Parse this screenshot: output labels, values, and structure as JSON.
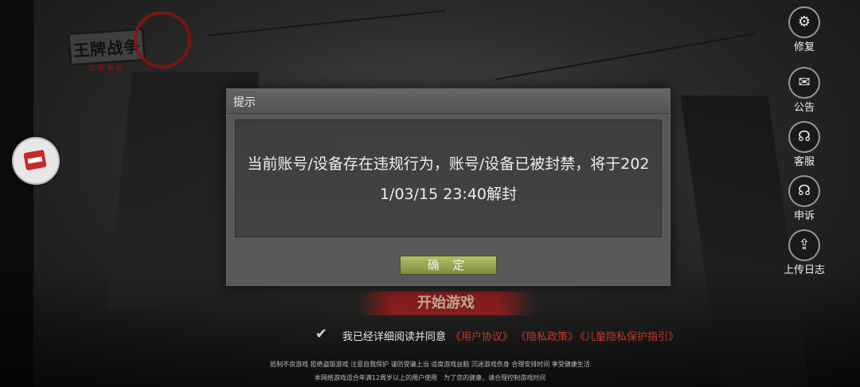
{
  "logo": {
    "text": "王牌战争",
    "subtitle": "文明重启"
  },
  "side_button": {
    "icon": "ruler-icon"
  },
  "right_menu": [
    {
      "label": "修复",
      "icon": "gear-icon"
    },
    {
      "label": "公告",
      "icon": "notice-icon"
    },
    {
      "label": "客服",
      "icon": "headset-icon"
    },
    {
      "label": "申诉",
      "icon": "headset-icon"
    },
    {
      "label": "上传日志",
      "icon": "upload-icon"
    }
  ],
  "dialog": {
    "title": "提示",
    "message_line1": "当前账号/设备存在违规行为，账号/设备已被封禁，将于202",
    "message_line2": "1/03/15 23:40解封",
    "confirm_label": "确 定"
  },
  "start_button": {
    "label": "开始游戏"
  },
  "agreement": {
    "checked": true,
    "text": "我已经详细阅读并同意",
    "link_user": "《用户协议》",
    "link_privacy": "《隐私政策》",
    "link_child": "《儿童隐私保护指引》"
  },
  "footer": {
    "line1": "抵制不良游戏 拒绝盗版游戏 注意自我保护 谨防受骗上当 适度游戏益脑 沉迷游戏伤身 合理安排时间 享受健康生活",
    "line2": "本网络游戏适合年满12周岁以上的用户使用　为了您的健康，请合理控制游戏时间"
  },
  "colors": {
    "accent_red": "#c0392b",
    "confirm_green": "#9aa84f"
  }
}
